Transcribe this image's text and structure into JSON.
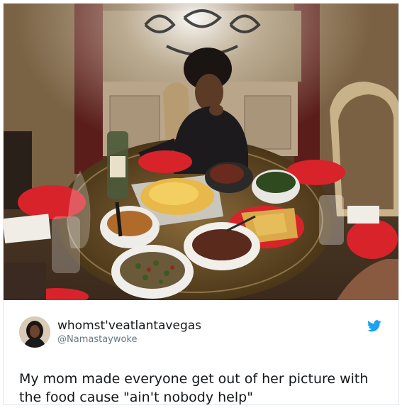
{
  "tweet": {
    "display_name": "whomst'veatlantavegas",
    "handle": "@Namastaywoke",
    "text": "My mom made everyone get out of her picture with the food cause \"ain't nobody help\""
  },
  "icons": {
    "brand": "twitter-bird-icon"
  },
  "colors": {
    "twitter_blue": "#1da1f2",
    "plate_red": "#d8232a"
  }
}
